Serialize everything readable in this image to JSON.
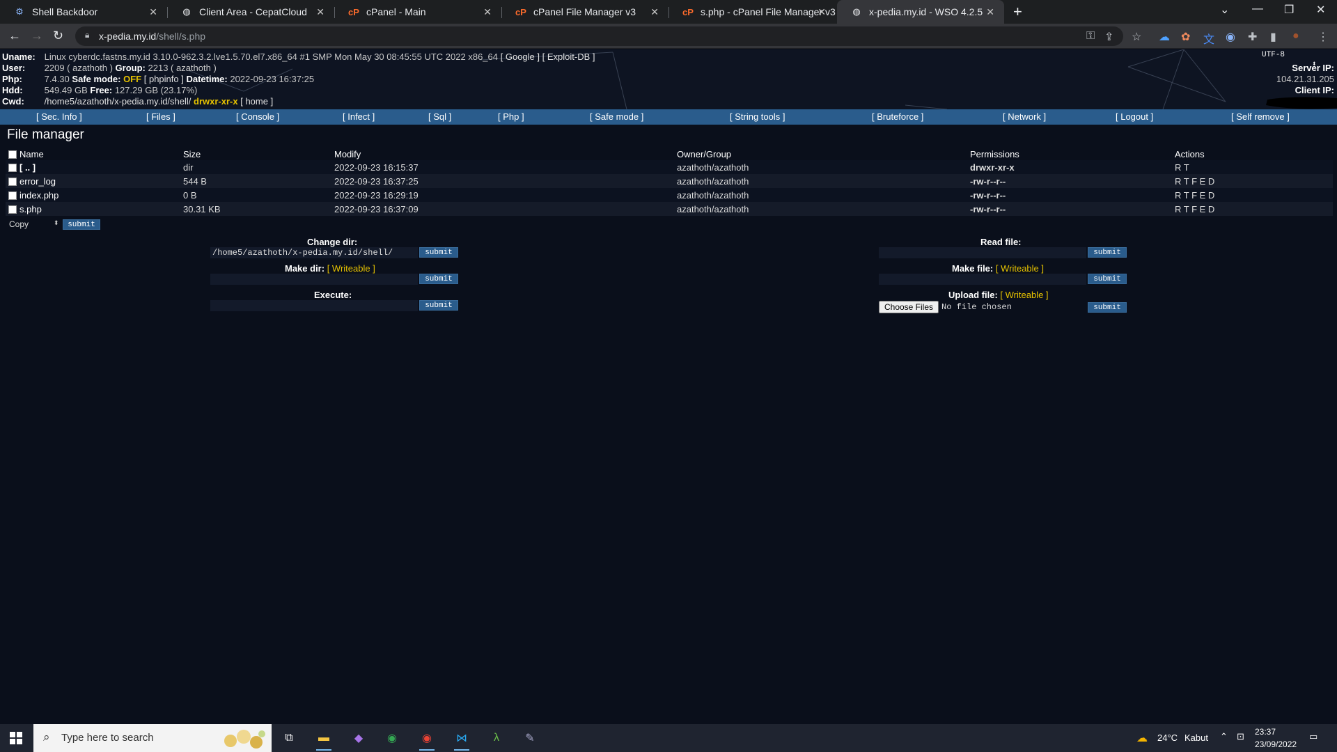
{
  "browser": {
    "tabs": [
      {
        "title": "Shell Backdoor",
        "icon": "gear-icon"
      },
      {
        "title": "Client Area - CepatCloud",
        "icon": "globe-icon"
      },
      {
        "title": "cPanel - Main",
        "icon": "cpanel-icon"
      },
      {
        "title": "cPanel File Manager v3",
        "icon": "cpanel-icon"
      },
      {
        "title": "s.php - cPanel File Manager v3",
        "icon": "cpanel-icon"
      },
      {
        "title": "x-pedia.my.id - WSO 4.2.5",
        "icon": "globe-icon",
        "active": true
      }
    ],
    "url_host": "x-pedia.my.id",
    "url_path": "/shell/s.php"
  },
  "header": {
    "uname_label": "Uname:",
    "uname_value": "Linux cyberdc.fastns.my.id 3.10.0-962.3.2.lve1.5.70.el7.x86_64 #1 SMP Mon May 30 08:45:55 UTC 2022 x86_64",
    "google": "[ Google ]",
    "exploitdb": "[ Exploit-DB ]",
    "user_label": "User:",
    "user_value": "2209 ( azathoth )",
    "group_label": "Group:",
    "group_value": "2213 ( azathoth )",
    "php_label": "Php:",
    "php_value": "7.4.30",
    "safemode_label": "Safe mode:",
    "safemode_value": "OFF",
    "phpinfo": "[ phpinfo ]",
    "datetime_label": "Datetime:",
    "datetime_value": "2022-09-23 16:37:25",
    "hdd_label": "Hdd:",
    "hdd_value": "549.49 GB",
    "free_label": "Free:",
    "free_value": "127.29 GB (23.17%)",
    "cwd_label": "Cwd:",
    "cwd_value": "/home5/azathoth/x-pedia.my.id/shell/",
    "cwd_perm": "drwxr-xr-x",
    "home": "[ home ]",
    "encoding": "UTF-8",
    "server_ip_label": "Server IP:",
    "server_ip_value": "104.21.31.205",
    "client_ip_label": "Client IP:"
  },
  "menu": [
    "[ Sec. Info ]",
    "[ Files ]",
    "[ Console ]",
    "[ Infect ]",
    "[ Sql ]",
    "[ Php ]",
    "[ Safe mode ]",
    "[ String tools ]",
    "[ Bruteforce ]",
    "[ Network ]",
    "[ Logout ]",
    "[ Self remove ]"
  ],
  "file_manager": {
    "title": "File manager",
    "columns": [
      "Name",
      "Size",
      "Modify",
      "Owner/Group",
      "Permissions",
      "Actions"
    ],
    "rows": [
      {
        "name": "[ .. ]",
        "size": "dir",
        "modify": "2022-09-23 16:15:37",
        "owner": "azathoth/azathoth",
        "perms": "drwxr-xr-x",
        "actions": "R T"
      },
      {
        "name": "error_log",
        "size": "544 B",
        "modify": "2022-09-23 16:37:25",
        "owner": "azathoth/azathoth",
        "perms": "-rw-r--r--",
        "actions": "R T F E D"
      },
      {
        "name": "index.php",
        "size": "0 B",
        "modify": "2022-09-23 16:29:19",
        "owner": "azathoth/azathoth",
        "perms": "-rw-r--r--",
        "actions": "R T F E D"
      },
      {
        "name": "s.php",
        "size": "30.31 KB",
        "modify": "2022-09-23 16:37:09",
        "owner": "azathoth/azathoth",
        "perms": "-rw-r--r--",
        "actions": "R T F E D"
      }
    ],
    "copy_option": "Copy",
    "submit": "submit"
  },
  "forms": {
    "change_dir_label": "Change dir:",
    "change_dir_value": "/home5/azathoth/x-pedia.my.id/shell/",
    "make_dir_label": "Make dir:",
    "writeable": "[ Writeable ]",
    "execute_label": "Execute:",
    "read_file_label": "Read file:",
    "make_file_label": "Make file:",
    "upload_file_label": "Upload file:",
    "choose_files": "Choose Files",
    "no_file": "No file chosen",
    "submit": "submit"
  },
  "taskbar": {
    "search_placeholder": "Type here to search",
    "temperature": "24°C",
    "weather": "Kabut",
    "time": "23:37",
    "date": "23/09/2022"
  }
}
